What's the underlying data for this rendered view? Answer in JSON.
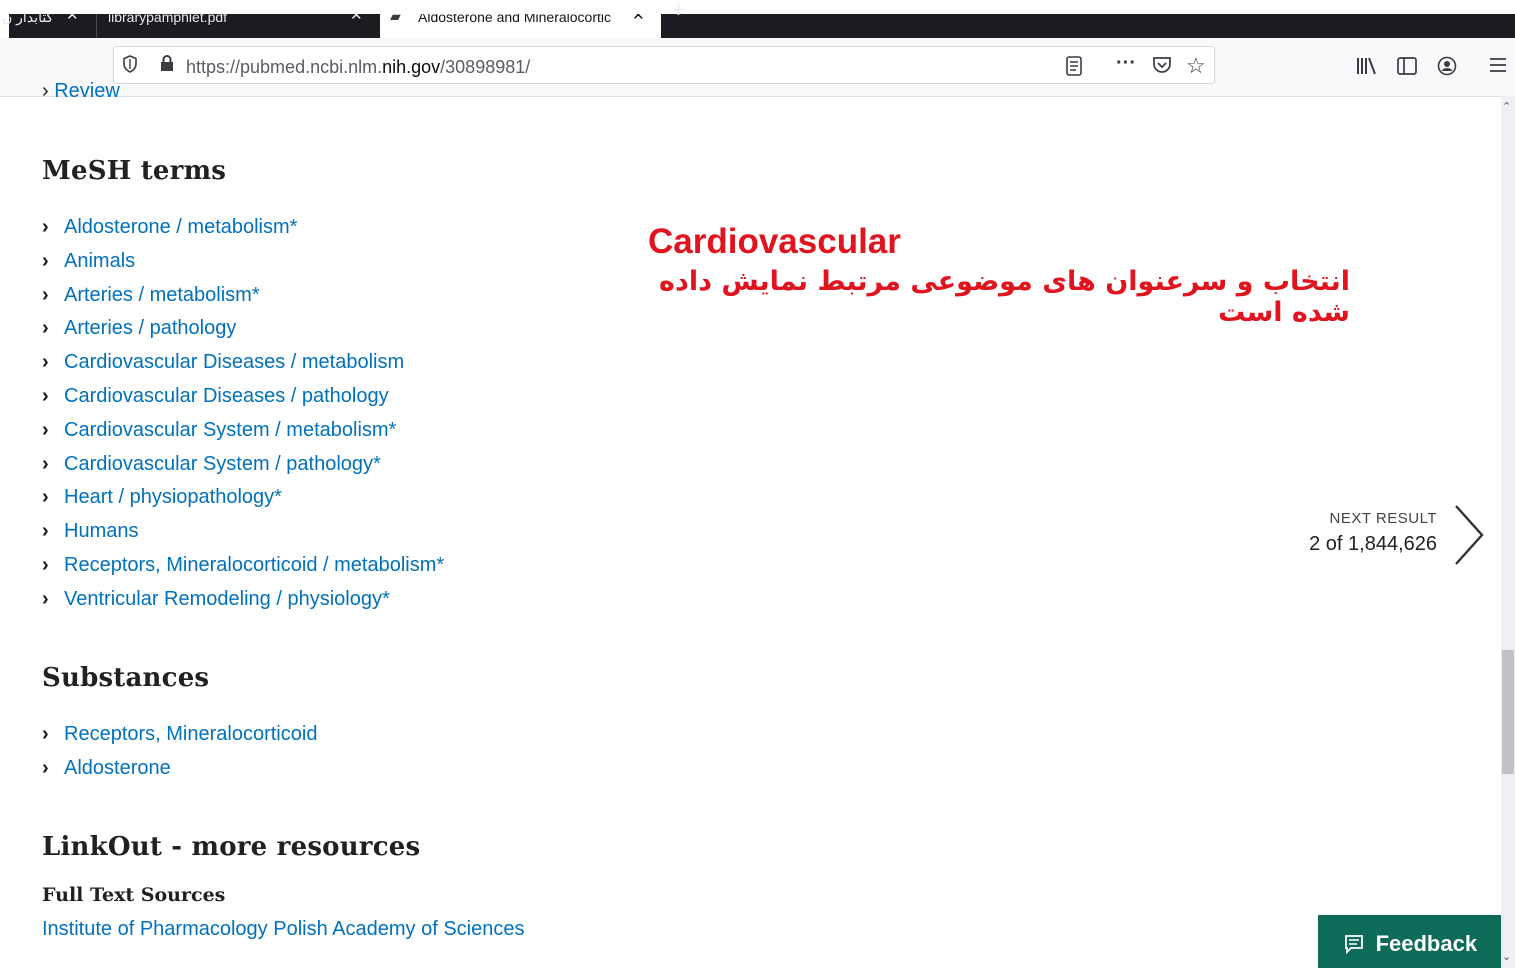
{
  "browser": {
    "tabs": [
      {
        "title": "کتابدار ن",
        "close": "✕"
      },
      {
        "title": "librarypamphlet.pdf",
        "close": "✕"
      },
      {
        "title": "Aldosterone and Mineralocortic",
        "close": "✕"
      }
    ],
    "new_tab": "+",
    "url_prefix": "https://pubmed.ncbi.nlm.",
    "url_host": "nih.gov",
    "url_path": "/30898981/"
  },
  "page": {
    "partial_item": "Review",
    "mesh": {
      "title": "MeSH terms",
      "items": [
        "Aldosterone / metabolism*",
        "Animals",
        "Arteries / metabolism*",
        "Arteries / pathology",
        "Cardiovascular Diseases / metabolism",
        "Cardiovascular Diseases / pathology",
        "Cardiovascular System / metabolism*",
        "Cardiovascular System / pathology*",
        "Heart / physiopathology*",
        "Humans",
        "Receptors, Mineralocorticoid / metabolism*",
        "Ventricular Remodeling / physiology*"
      ]
    },
    "substances": {
      "title": "Substances",
      "items": [
        "Receptors, Mineralocorticoid",
        "Aldosterone"
      ]
    },
    "linkout": {
      "title": "LinkOut - more resources",
      "full_text_label": "Full Text Sources",
      "full_text_link": "Institute of Pharmacology Polish Academy of Sciences"
    },
    "annotation": {
      "english": "Cardiovascular",
      "persian": "انتخاب و سرعنوان های موضوعی مرتبط نمایش داده شده است",
      "color": "#e0141e"
    },
    "next_result": {
      "label": "NEXT RESULT",
      "count": "2 of 1,844,626"
    },
    "feedback_label": "Feedback"
  },
  "colors": {
    "link": "#0071bc",
    "feedback_bg": "#0e6b57",
    "tabbar_dark": "#1c1b22"
  }
}
